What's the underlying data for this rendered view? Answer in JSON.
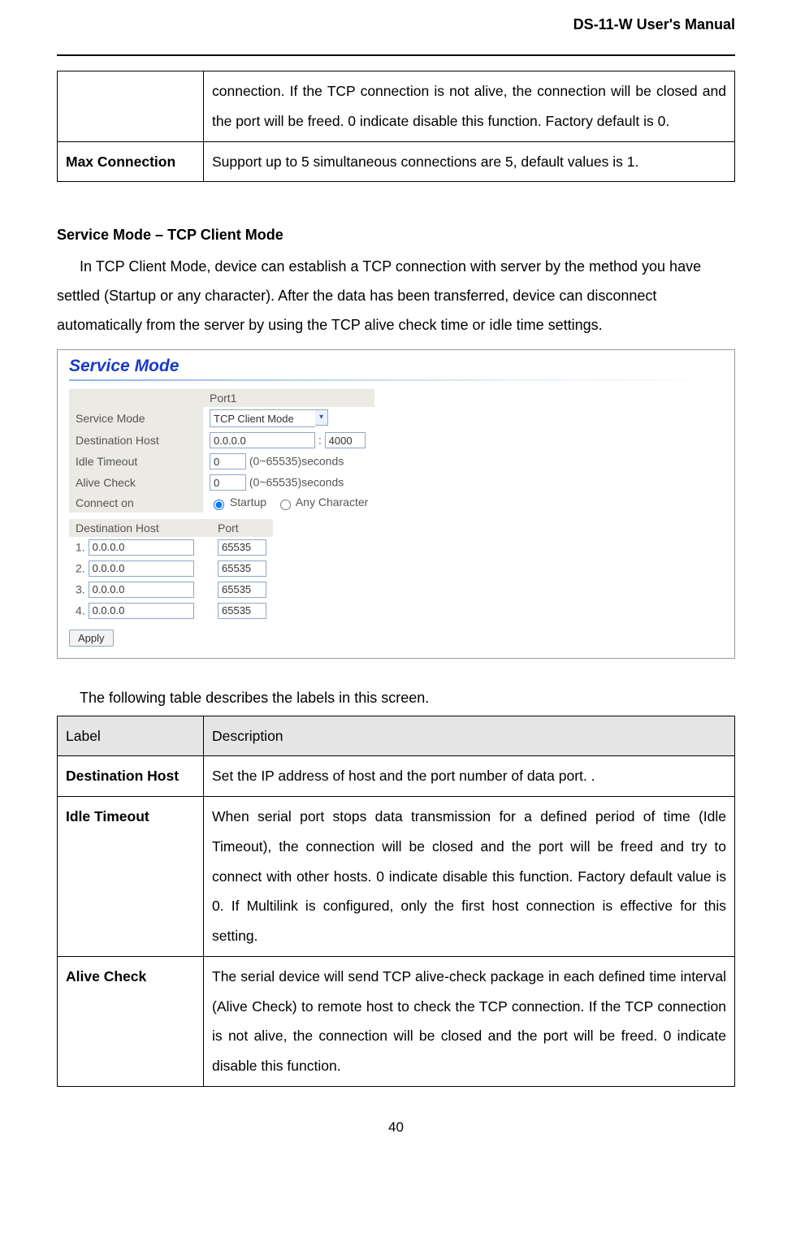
{
  "doc_title": "DS-11-W User's Manual",
  "page_number": "40",
  "top_table": {
    "row1_label": "",
    "row1_desc": "connection.   If the TCP connection is not alive, the connection will be closed and the port will be freed.   0 indicate disable this function. Factory default is 0.",
    "row2_label": "Max Connection",
    "row2_desc": "Support up to 5 simultaneous connections are 5, default values is 1."
  },
  "section_heading": "Service Mode – TCP Client Mode",
  "intro_text": "In TCP Client Mode, device can establish a TCP connection with server by the method you have settled (Startup or any character).   After the data has been transferred, device can disconnect automatically from the server by using the TCP alive check time or idle time settings.",
  "screenshot": {
    "title": "Service Mode",
    "port_header": "Port1",
    "rows": {
      "service_mode_label": "Service Mode",
      "service_mode_value": "TCP Client Mode",
      "dest_host_label": "Destination Host",
      "dest_host_ip": "0.0.0.0",
      "dest_host_port": "4000",
      "idle_timeout_label": "Idle Timeout",
      "idle_timeout_value": "0",
      "idle_timeout_suffix": "(0~65535)seconds",
      "alive_check_label": "Alive Check",
      "alive_check_value": "0",
      "alive_check_suffix": "(0~65535)seconds",
      "connect_on_label": "Connect on",
      "connect_on_option1": "Startup",
      "connect_on_option2": "Any Character"
    },
    "host_table": {
      "col1": "Destination Host",
      "col2": "Port",
      "rows": [
        {
          "n": "1.",
          "host": "0.0.0.0",
          "port": "65535"
        },
        {
          "n": "2.",
          "host": "0.0.0.0",
          "port": "65535"
        },
        {
          "n": "3.",
          "host": "0.0.0.0",
          "port": "65535"
        },
        {
          "n": "4.",
          "host": "0.0.0.0",
          "port": "65535"
        }
      ]
    },
    "apply": "Apply"
  },
  "below_caption": "The following table describes the labels in this screen.",
  "desc_table": {
    "h1": "Label",
    "h2": "Description",
    "rows": [
      {
        "label": "Destination Host",
        "desc": "Set the IP address of host and the port number of data port.   ."
      },
      {
        "label": "Idle Timeout",
        "desc": "When serial port stops data transmission for a defined period of time (Idle Timeout), the connection will be closed and the port will be freed and try to connect with other hosts.   0 indicate disable this function. Factory default value is 0.   If Multilink is configured, only the first host connection is effective for this setting."
      },
      {
        "label": "Alive Check",
        "desc": "The serial device will send TCP alive-check package in each defined time interval (Alive Check) to remote host to check the TCP connection.   If the TCP connection is not alive, the connection will be closed and the port will be freed.   0 indicate disable this function."
      }
    ]
  }
}
